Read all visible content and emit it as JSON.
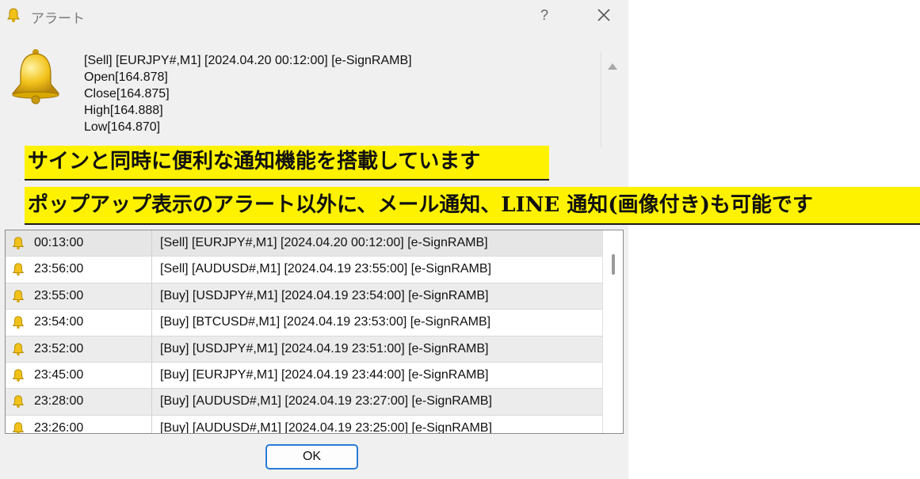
{
  "window": {
    "title": "アラート",
    "help_label": "?"
  },
  "detail": {
    "lines": [
      "[Sell] [EURJPY#,M1] [2024.04.20 00:12:00] [e-SignRAMB]",
      "Open[164.878]",
      "Close[164.875]",
      "High[164.888]",
      "Low[164.870]"
    ]
  },
  "annotations": {
    "line1": "サインと同時に便利な通知機能を搭載しています",
    "line2": "ポップアップ表示のアラート以外に、メール通知、LINE 通知(画像付き)も可能です",
    "highlight_color": "#fff200"
  },
  "alerts": [
    {
      "time": "00:13:00",
      "message": "[Sell] [EURJPY#,M1] [2024.04.20 00:12:00] [e-SignRAMB]"
    },
    {
      "time": "23:56:00",
      "message": "[Sell] [AUDUSD#,M1] [2024.04.19 23:55:00] [e-SignRAMB]"
    },
    {
      "time": "23:55:00",
      "message": "[Buy] [USDJPY#,M1] [2024.04.19 23:54:00] [e-SignRAMB]"
    },
    {
      "time": "23:54:00",
      "message": "[Buy] [BTCUSD#,M1] [2024.04.19 23:53:00] [e-SignRAMB]"
    },
    {
      "time": "23:52:00",
      "message": "[Buy] [USDJPY#,M1] [2024.04.19 23:51:00] [e-SignRAMB]"
    },
    {
      "time": "23:45:00",
      "message": "[Buy] [EURJPY#,M1] [2024.04.19 23:44:00] [e-SignRAMB]"
    },
    {
      "time": "23:28:00",
      "message": "[Buy] [AUDUSD#,M1] [2024.04.19 23:27:00] [e-SignRAMB]"
    },
    {
      "time": "23:26:00",
      "message": "[Buy] [AUDUSD#,M1] [2024.04.19 23:25:00] [e-SignRAMB]"
    }
  ],
  "buttons": {
    "ok_label": "OK"
  },
  "icons": {
    "bell": "bell-icon",
    "close": "close-icon",
    "help": "help-icon",
    "scroll_up": "scroll-up-arrow-icon"
  },
  "colors": {
    "bell_gold": "#f2c21a",
    "ok_border": "#2a7ad8"
  }
}
